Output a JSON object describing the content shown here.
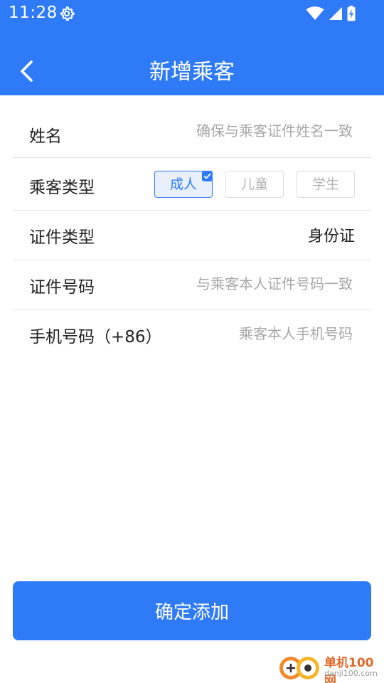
{
  "status_bar": {
    "time": "11:28",
    "icons": [
      "gear-icon",
      "wifi-icon",
      "signal-icon",
      "battery-charging-icon"
    ]
  },
  "header": {
    "title": "新增乘客",
    "back_icon": "chevron-left-icon"
  },
  "form": {
    "name": {
      "label": "姓名",
      "placeholder": "确保与乘客证件姓名一致",
      "value": ""
    },
    "passenger_type": {
      "label": "乘客类型",
      "options": [
        "成人",
        "儿童",
        "学生"
      ],
      "selected": "成人"
    },
    "id_type": {
      "label": "证件类型",
      "value": "身份证"
    },
    "id_number": {
      "label": "证件号码",
      "placeholder": "与乘客本人证件号码一致",
      "value": ""
    },
    "phone": {
      "label": "手机号码（+86）",
      "placeholder": "乘客本人手机号码",
      "value": ""
    }
  },
  "submit": {
    "label": "确定添加"
  },
  "watermark": {
    "name": "单机100网",
    "url": "danji100.com"
  },
  "colors": {
    "primary": "#2f7bf7",
    "placeholder": "#a8a8a8",
    "divider": "#e4e4e4"
  }
}
